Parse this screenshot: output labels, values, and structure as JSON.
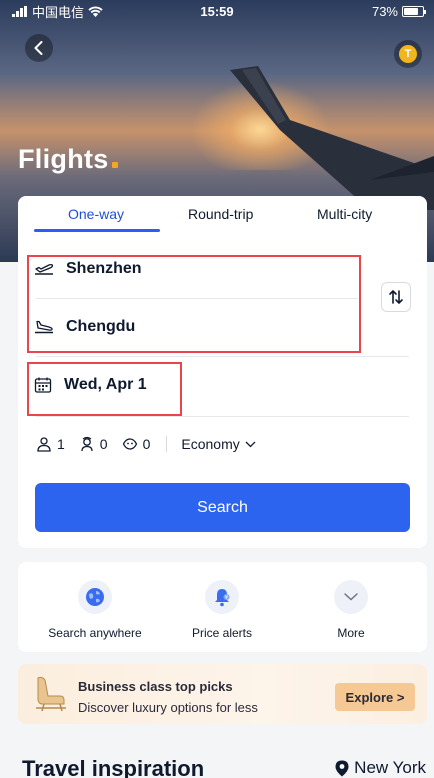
{
  "status_bar": {
    "carrier": "中国电信",
    "time": "15:59",
    "battery": "73%"
  },
  "page": {
    "title": "Flights"
  },
  "tabs": [
    {
      "label": "One-way",
      "active": true
    },
    {
      "label": "Round-trip",
      "active": false
    },
    {
      "label": "Multi-city",
      "active": false
    }
  ],
  "search_form": {
    "origin": "Shenzhen",
    "destination": "Chengdu",
    "date": "Wed, Apr 1",
    "adults": "1",
    "children": "0",
    "infants": "0",
    "cabin_class": "Economy",
    "search_label": "Search"
  },
  "quick_actions": [
    {
      "label": "Search anywhere",
      "icon": "globe-icon"
    },
    {
      "label": "Price alerts",
      "icon": "bell-icon"
    },
    {
      "label": "More",
      "icon": "chevron-down-icon"
    }
  ],
  "promo": {
    "title": "Business class top picks",
    "subtitle": "Discover luxury options for less",
    "cta": "Explore >"
  },
  "inspiration": {
    "heading": "Travel inspiration",
    "location": "New York"
  },
  "colors": {
    "primary": "#2d64ef",
    "accent_dot": "#f5a623",
    "highlight_box": "#e8454d",
    "promo_button": "#f5c894"
  }
}
